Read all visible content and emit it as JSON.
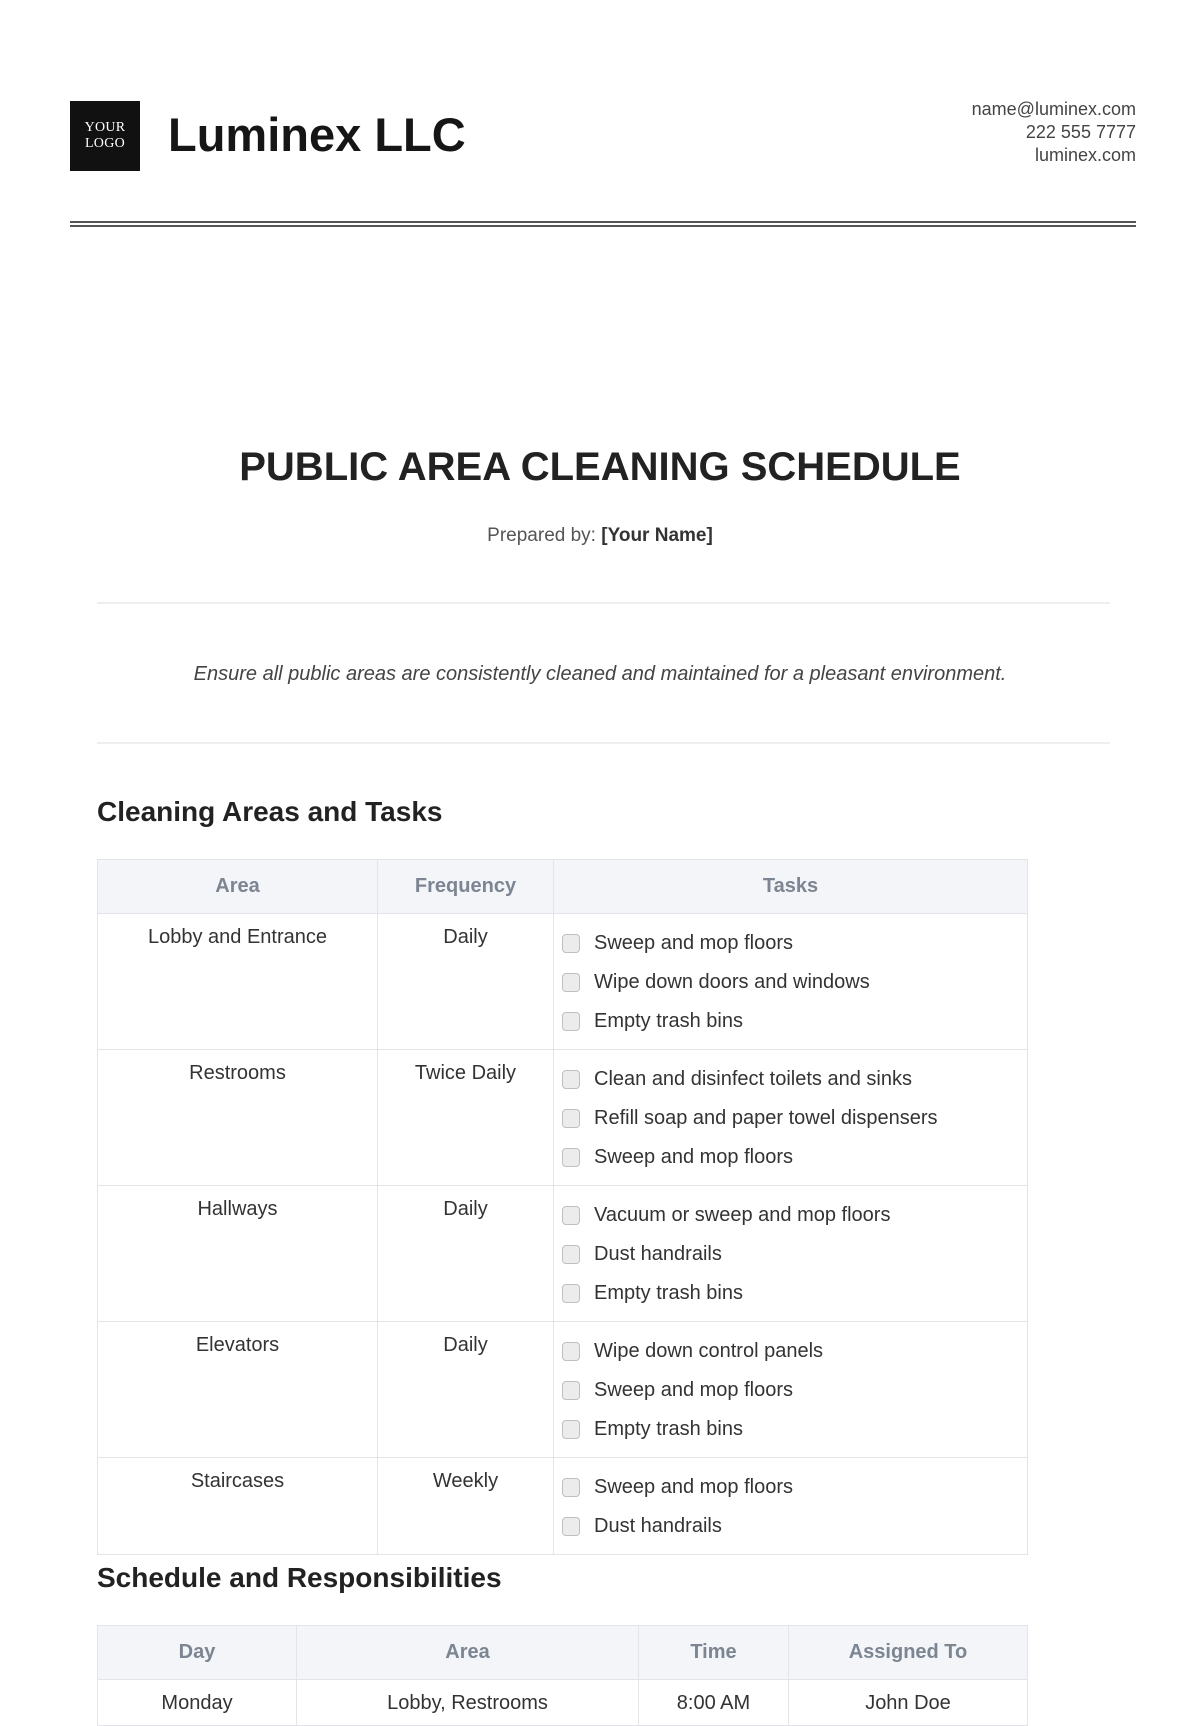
{
  "header": {
    "logo_line1": "YOUR",
    "logo_line2": "LOGO",
    "company": "Luminex LLC",
    "email": "name@luminex.com",
    "phone": "222 555 7777",
    "website": "luminex.com"
  },
  "doc": {
    "title": "PUBLIC AREA CLEANING SCHEDULE",
    "prepared_label": "Prepared by:",
    "prepared_name": "[Your Name]",
    "tagline": "Ensure all public areas are consistently cleaned and maintained for a pleasant environment."
  },
  "cleaning": {
    "heading": "Cleaning Areas and Tasks",
    "columns": [
      "Area",
      "Frequency",
      "Tasks"
    ],
    "rows": [
      {
        "area": "Lobby and Entrance",
        "frequency": "Daily",
        "tasks": [
          "Sweep and mop floors",
          "Wipe down doors and windows",
          "Empty trash bins"
        ]
      },
      {
        "area": "Restrooms",
        "frequency": "Twice Daily",
        "tasks": [
          "Clean and disinfect toilets and sinks",
          "Refill soap and paper towel dispensers",
          "Sweep and mop floors"
        ]
      },
      {
        "area": "Hallways",
        "frequency": "Daily",
        "tasks": [
          "Vacuum or sweep and mop floors",
          "Dust handrails",
          "Empty trash bins"
        ]
      },
      {
        "area": "Elevators",
        "frequency": "Daily",
        "tasks": [
          "Wipe down control panels",
          "Sweep and mop floors",
          "Empty trash bins"
        ]
      },
      {
        "area": "Staircases",
        "frequency": "Weekly",
        "tasks": [
          "Sweep and mop floors",
          "Dust handrails"
        ]
      }
    ]
  },
  "schedule": {
    "heading": "Schedule and Responsibilities",
    "columns": [
      "Day",
      "Area",
      "Time",
      "Assigned To"
    ],
    "rows": [
      {
        "day": "Monday",
        "area": "Lobby, Restrooms",
        "time": "8:00 AM",
        "assigned": "John Doe"
      }
    ]
  }
}
